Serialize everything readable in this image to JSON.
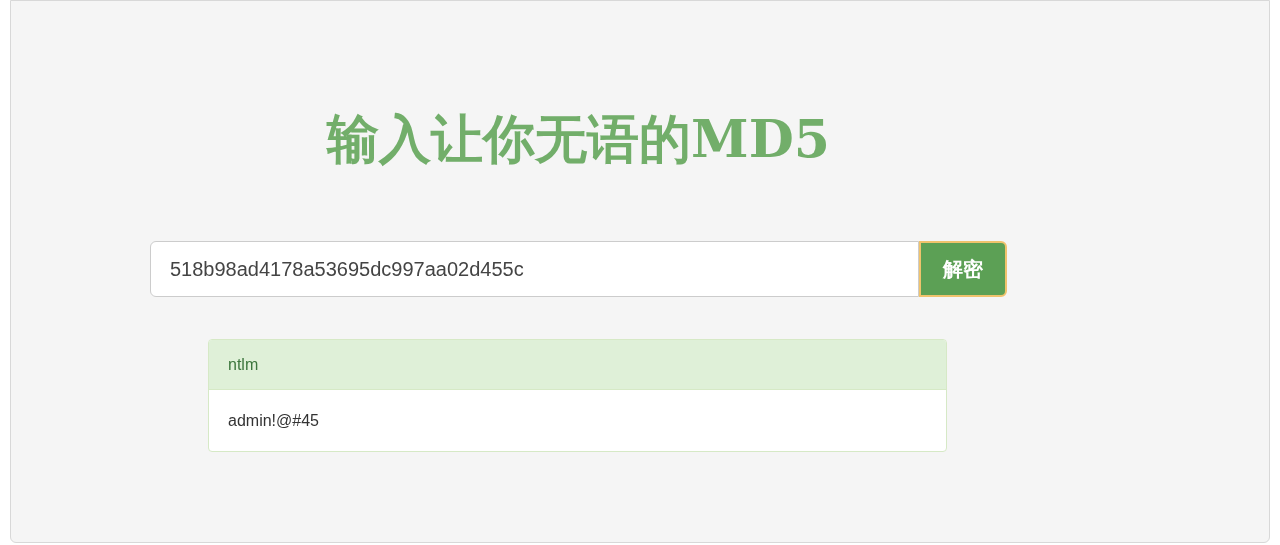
{
  "title": "输入让你无语的MD5",
  "search": {
    "value": "518b98ad4178a53695dc997aa02d455c",
    "button": "解密"
  },
  "result": {
    "type": "ntlm",
    "value": "admin!@#45"
  }
}
